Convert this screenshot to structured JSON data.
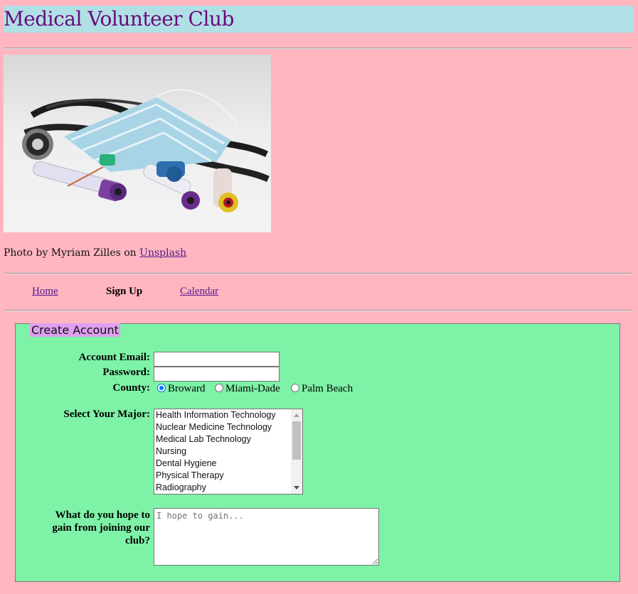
{
  "header": {
    "title": "Medical Volunteer Club"
  },
  "photo": {
    "alt": "stethoscope, face mask and blood sample tubes"
  },
  "credit": {
    "prefix": "Photo by Myriam Zilles on",
    "link": "Unsplash"
  },
  "nav": {
    "home": "Home",
    "signup": "Sign Up",
    "calendar": "Calendar"
  },
  "form": {
    "legend": "Create Account",
    "email_label": "Account Email:",
    "email_value": "",
    "password_label": "Password:",
    "password_value": "",
    "county_label": "County:",
    "counties": [
      "Broward",
      "Miami-Dade",
      "Palm Beach"
    ],
    "county_selected": "Broward",
    "major_label": "Select Your Major:",
    "majors": [
      "Health Information Technology",
      "Nuclear Medicine Technology",
      "Medical Lab Technology",
      "Nursing",
      "Dental Hygiene",
      "Physical Therapy",
      "Radiography"
    ],
    "hope_label_1": "What do you hope to",
    "hope_label_2": "gain from joining our",
    "hope_label_3": "club?",
    "hope_placeholder": "I hope to gain..."
  },
  "colors": {
    "page_bg": "#ffb6c1",
    "banner_bg": "#b0e0e6",
    "title": "#6a0a7a",
    "form_bg": "#7ef2a7",
    "legend_bg": "#df9ff0",
    "link": "#551a8b"
  }
}
